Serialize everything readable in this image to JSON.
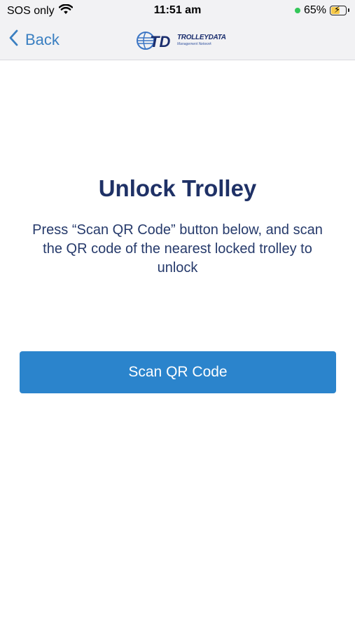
{
  "status_bar": {
    "carrier": "SOS only",
    "time": "11:51 am",
    "battery_percent": "65%",
    "battery_level": 0.65,
    "wifi_icon": "wifi-icon",
    "charging_icon": "bolt-icon"
  },
  "nav": {
    "back_label": "Back",
    "logo": {
      "main": "TROLLEYDATA",
      "sub": "Management Network",
      "mark": "TD"
    }
  },
  "main": {
    "title": "Unlock Trolley",
    "message": "Press “Scan QR Code” button below, and scan the QR code of the nearest locked trolley to unlock",
    "scan_button_label": "Scan QR Code"
  },
  "colors": {
    "accent": "#2b84cc",
    "title": "#1f3166",
    "back": "#3a7fc1"
  }
}
